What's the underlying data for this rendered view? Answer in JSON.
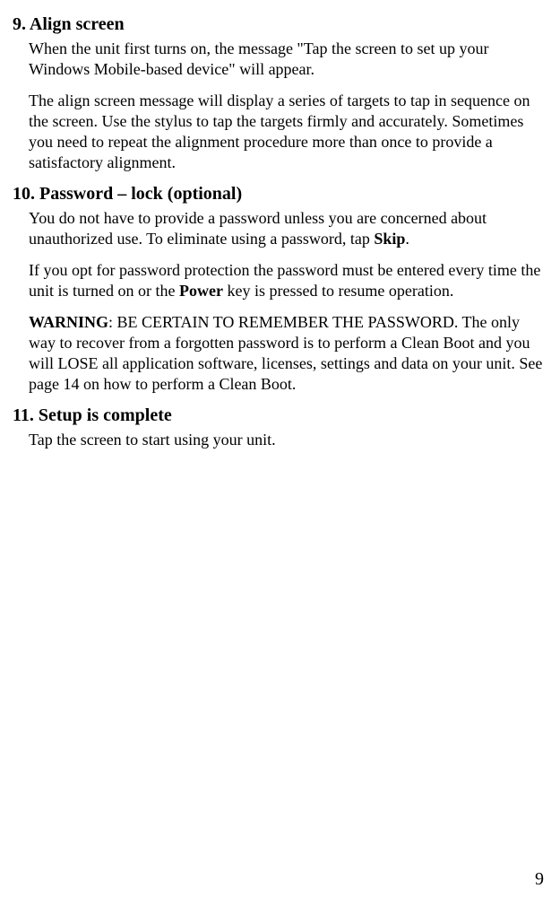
{
  "sections": {
    "s9": {
      "heading": "9. Align screen",
      "p1": "When the unit first turns on, the message \"Tap the screen to set up your Windows Mobile-based device\" will appear.",
      "p2": "The align screen message will display a series of targets to tap in sequence on the screen. Use the stylus to tap the targets firmly and accurately. Sometimes you need to repeat the alignment procedure more than once to provide a satisfactory alignment."
    },
    "s10": {
      "heading": "10. Password – lock (optional)",
      "p1a": "You do not have to provide a password unless you are concerned about unauthorized use. To eliminate using a password, tap ",
      "p1b": "Skip",
      "p1c": ".",
      "p2a": "If you opt for password protection the password must be entered every time the unit is turned on or the ",
      "p2b": "Power",
      "p2c": " key is pressed to resume operation.",
      "p3a": "WARNING",
      "p3b": ": BE CERTAIN TO REMEMBER THE PASSWORD. The only way to recover from a forgotten password is to perform a Clean Boot and you will LOSE all application software, licenses, settings and data on your unit. See page 14 on how to perform a Clean Boot."
    },
    "s11": {
      "heading": "11. Setup is complete",
      "p1": "Tap the screen to start using your unit."
    }
  },
  "page_number": "9"
}
